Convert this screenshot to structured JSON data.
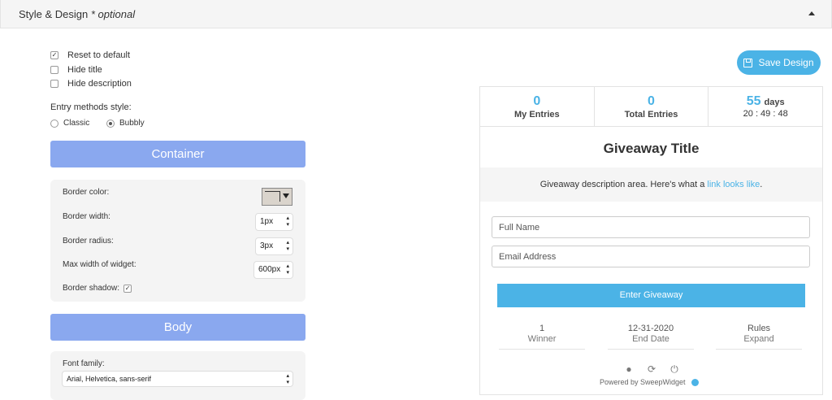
{
  "header": {
    "title": "Style & Design",
    "optional": "* optional"
  },
  "options": [
    {
      "label": "Reset to default",
      "checked": true
    },
    {
      "label": "Hide title",
      "checked": false
    },
    {
      "label": "Hide description",
      "checked": false
    }
  ],
  "entry_style": {
    "label": "Entry methods style:",
    "options": [
      {
        "label": "Classic",
        "selected": false
      },
      {
        "label": "Bubbly",
        "selected": true
      }
    ]
  },
  "container": {
    "title": "Container",
    "border_color_label": "Border color:",
    "border_width_label": "Border width:",
    "border_width_value": "1px",
    "border_radius_label": "Border radius:",
    "border_radius_value": "3px",
    "max_width_label": "Max width of widget:",
    "max_width_value": "600px",
    "border_shadow_label": "Border shadow:",
    "border_shadow_checked": true
  },
  "body": {
    "title": "Body",
    "font_family_label": "Font family:",
    "font_family_value": "Arial, Helvetica, sans-serif"
  },
  "save_button": "Save Design",
  "widget": {
    "my_entries_value": "0",
    "my_entries_label": "My Entries",
    "total_entries_value": "0",
    "total_entries_label": "Total Entries",
    "days_value": "55",
    "days_label": "days",
    "timer": "20 : 49 : 48",
    "title": "Giveaway Title",
    "description_prefix": "Giveaway description area. Here's what a ",
    "description_link": "link looks like",
    "description_suffix": ".",
    "full_name_placeholder": "Full Name",
    "email_placeholder": "Email Address",
    "enter_button": "Enter Giveaway",
    "footer": [
      {
        "value": "1",
        "label": "Winner"
      },
      {
        "value": "12-31-2020",
        "label": "End Date"
      },
      {
        "value": "Rules",
        "label": "Expand"
      }
    ],
    "powered_by": "Powered by SweepWidget"
  },
  "colors": {
    "accent": "#4bb3e6",
    "section_bar": "#8aa8ef",
    "panel": "#f4f4f4"
  }
}
